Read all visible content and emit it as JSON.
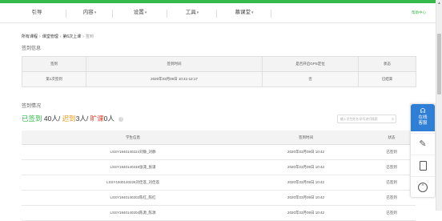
{
  "nav": {
    "items": [
      "引导",
      "内容",
      "设置",
      "工具",
      "慕课堂"
    ],
    "help": "帮助中心"
  },
  "breadcrumb": {
    "items": [
      "所有课程",
      "课堂管理",
      "第6次上课"
    ],
    "current": "签到"
  },
  "signin_info": {
    "section_title": "签到信息",
    "headers": [
      "签到",
      "签到时间",
      "是否开启GPS定位",
      "状态"
    ],
    "row": [
      "第1次签到",
      "2020年03月09日 10:41-12:17",
      "否",
      "已结束"
    ]
  },
  "signin_status": {
    "section_title": "签到情况",
    "signed_label": "已签到",
    "signed_count": "40人",
    "late_label": "迟到",
    "late_count": "3人",
    "absent_label": "旷课",
    "absent_count": "0人",
    "info_icon_glyph": "i"
  },
  "search": {
    "placeholder": "输入学生姓名/学号进行搜索"
  },
  "students": {
    "headers": [
      "学生信息",
      "签到时间",
      "状态"
    ],
    "rows": [
      [
        "LSSY1940140224刘静_刘静",
        "2020年03月09日 10:42",
        "已签到"
      ],
      [
        "LSSY1940140248张潇_张潇",
        "2020年03月09日 10:42",
        "已签到"
      ],
      [
        "LSSY1940140226刘佳莲_刘佳莲",
        "2020年03月09日 10:42",
        "已签到"
      ],
      [
        "LSSY1940140202陈红_陈红",
        "2020年03月09日 10:42",
        "已签到"
      ],
      [
        "LSSY1940140204陈源_陈源",
        "2020年03月09日 10:42",
        "已签到"
      ]
    ]
  },
  "float_panel": {
    "top_label_1": "在线",
    "top_label_2": "客服"
  },
  "colors": {
    "brand_green": "#35b94a",
    "late_orange": "#f39b1b",
    "absent_red": "#e8402f",
    "panel_blue": "#2f7fd6"
  },
  "icons": [
    "headset-icon",
    "pencil-icon",
    "tablet-icon",
    "scroll-top-icon",
    "search-icon",
    "info-icon"
  ]
}
